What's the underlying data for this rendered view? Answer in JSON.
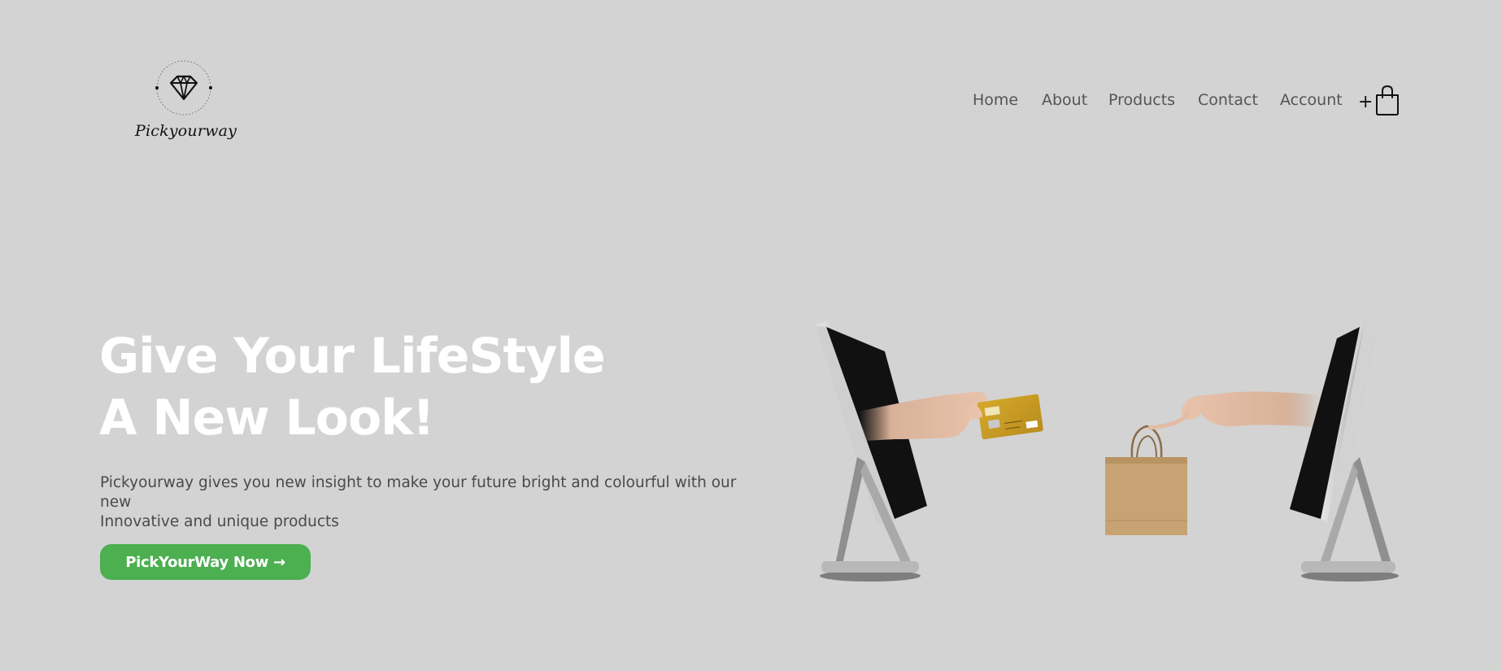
{
  "brand": {
    "name": "Pickyourway",
    "logo_icon": "diamond-icon"
  },
  "nav": {
    "items": [
      {
        "label": "Home"
      },
      {
        "label": "About"
      },
      {
        "label": "Products"
      },
      {
        "label": "Contact"
      },
      {
        "label": "Account"
      }
    ],
    "cart": {
      "plus": "+",
      "icon": "shopping-bag-icon"
    }
  },
  "hero": {
    "title_line1": "Give Your LifeStyle",
    "title_line2": "A New Look!",
    "description_line1": "Pickyourway gives you new insight to make your future bright and colourful with our new",
    "description_line2": "Innovative and unique products",
    "cta_label": "PickYourWay Now →",
    "illustration": "online-shopping-illustration"
  },
  "colors": {
    "background": "#d3d3d3",
    "accent": "#4caf50",
    "title": "#ffffff",
    "nav_text": "#555555"
  }
}
